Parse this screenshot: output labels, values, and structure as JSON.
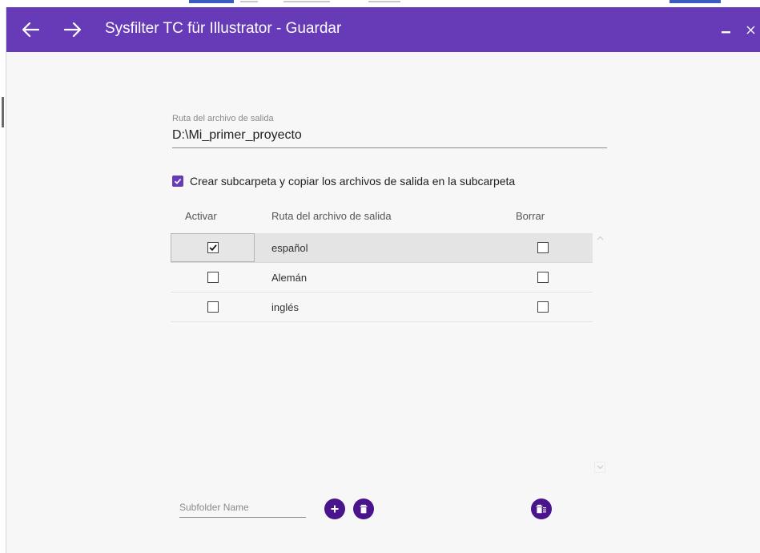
{
  "window": {
    "title": "Sysfilter TC für Illustrator - Guardar"
  },
  "output": {
    "label": "Ruta del archivo de salida",
    "value": "D:\\Mi_primer_proyecto"
  },
  "subfolder_option": {
    "label": "Crear subcarpeta y copiar los archivos de salida en la subcarpeta",
    "checked": true
  },
  "table": {
    "headers": [
      "Activar",
      "Ruta del archivo de salida",
      "Borrar"
    ],
    "rows": [
      {
        "name": "español",
        "activate": true,
        "delete": false
      },
      {
        "name": "Alemán",
        "activate": false,
        "delete": false
      },
      {
        "name": "inglés",
        "activate": false,
        "delete": false
      }
    ]
  },
  "subfolder": {
    "placeholder": "Subfolder Name"
  },
  "icons": {
    "back": "arrow-left-icon",
    "forward": "arrow-right-icon",
    "minimize": "minimize-icon",
    "close": "close-icon",
    "add": "plus-icon",
    "delete": "trash-icon",
    "delete_selected": "trash-list-icon"
  },
  "colors": {
    "accent": "#673ab7",
    "button": "#4a148c"
  }
}
